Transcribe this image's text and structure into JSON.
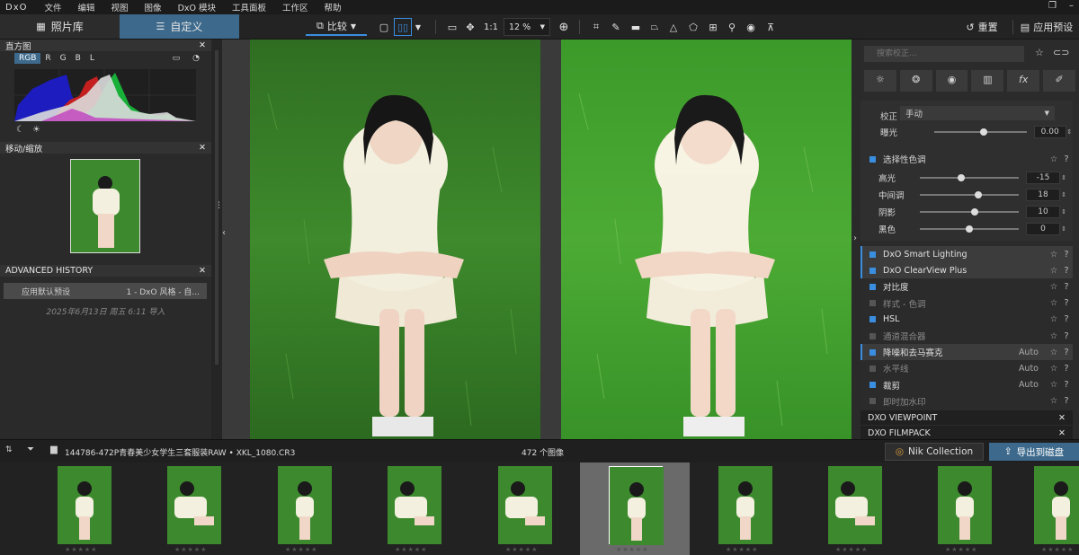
{
  "menubar": {
    "logo": "DxO",
    "items": [
      "文件",
      "编辑",
      "视图",
      "图像",
      "DxO 模块",
      "工具面板",
      "工作区",
      "帮助"
    ]
  },
  "toolbar": {
    "tab_photo": "照片库",
    "tab_custom": "自定义",
    "compare": "比较",
    "one_to_one": "1:1",
    "zoom": "12 %",
    "reset": "重置",
    "apply_preset": "应用预设"
  },
  "left": {
    "histogram_title": "直方图",
    "histo_channels": [
      "RGB",
      "R",
      "G",
      "B",
      "L"
    ],
    "movezoom_title": "移动/缩放",
    "history_title": "ADVANCED HISTORY",
    "history_item_label": "应用默认预设",
    "history_item_value": "1 - DxO 风格 - 自...",
    "history_date": "2025年6月13日 周五 6:11 导入"
  },
  "right": {
    "search_placeholder": "搜索校正...",
    "correction_label": "校正",
    "correction_value": "手动",
    "exposure_label": "曝光",
    "exposure_value": "0.00",
    "selective_tone": "选择性色调",
    "tone_sliders": [
      {
        "label": "高光",
        "value": "-15",
        "pos": 0.42
      },
      {
        "label": "中间调",
        "value": "18",
        "pos": 0.59
      },
      {
        "label": "阴影",
        "value": "10",
        "pos": 0.55
      },
      {
        "label": "黑色",
        "value": "0",
        "pos": 0.5
      }
    ],
    "exposure_pos": 0.5,
    "modules": [
      {
        "label": "DxO Smart Lighting",
        "on": true,
        "hl": true,
        "edge": true,
        "val": ""
      },
      {
        "label": "DxO ClearView Plus",
        "on": true,
        "hl": true,
        "edge": true,
        "val": ""
      },
      {
        "label": "对比度",
        "on": true,
        "hl": false,
        "edge": false,
        "val": ""
      },
      {
        "label": "样式 - 色调",
        "on": false,
        "hl": false,
        "edge": false,
        "val": ""
      },
      {
        "label": "HSL",
        "on": true,
        "hl": false,
        "edge": false,
        "val": ""
      },
      {
        "label": "通道混合器",
        "on": false,
        "hl": false,
        "edge": false,
        "val": ""
      },
      {
        "label": "降噪和去马赛克",
        "on": true,
        "hl": true,
        "edge": true,
        "val": "Auto"
      },
      {
        "label": "水平线",
        "on": false,
        "hl": false,
        "edge": false,
        "val": "Auto"
      },
      {
        "label": "裁剪",
        "on": true,
        "hl": false,
        "edge": false,
        "val": "Auto"
      },
      {
        "label": "即时加水印",
        "on": false,
        "hl": false,
        "edge": false,
        "val": ""
      }
    ],
    "section_viewpoint": "DXO VIEWPOINT",
    "section_filmpack": "DXO FILMPACK"
  },
  "filmhead": {
    "path": "144786-472P青春美少女学生三套服装RAW • XKL_1080.CR3",
    "count": "472 个图像",
    "nik": "Nik Collection",
    "export": "导出到磁盘"
  },
  "colors": {
    "accent": "#3d6a8c",
    "blue": "#3a8ee0",
    "grass": "#3f8a2f"
  }
}
